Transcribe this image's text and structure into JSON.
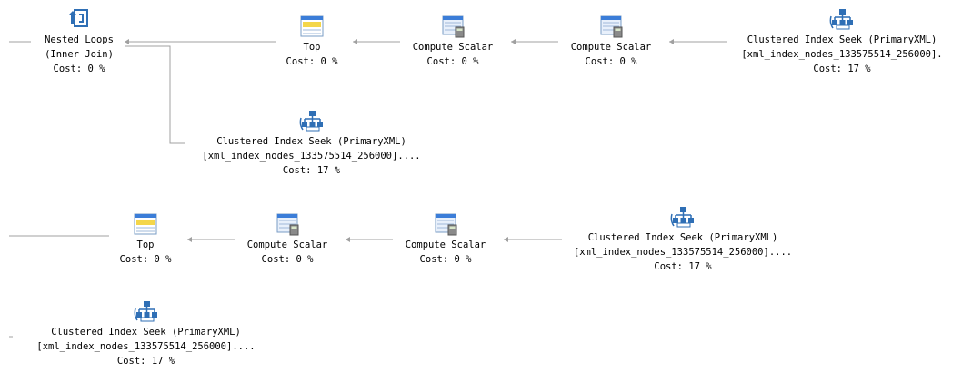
{
  "plan": {
    "nodes": {
      "nested_loops": {
        "name": "Nested Loops",
        "sub": "(Inner Join)",
        "cost": "Cost: 0 %"
      },
      "top_1": {
        "name": "Top",
        "cost": "Cost: 0 %"
      },
      "cs_1a": {
        "name": "Compute Scalar",
        "cost": "Cost: 0 %"
      },
      "cs_1b": {
        "name": "Compute Scalar",
        "cost": "Cost: 0 %"
      },
      "cis_1": {
        "name": "Clustered Index Seek (PrimaryXML)",
        "sub": "[xml_index_nodes_133575514_256000].",
        "cost": "Cost: 17 %"
      },
      "cis_2": {
        "name": "Clustered Index Seek (PrimaryXML)",
        "sub": "[xml_index_nodes_133575514_256000]....",
        "cost": "Cost: 17 %"
      },
      "top_2": {
        "name": "Top",
        "cost": "Cost: 0 %"
      },
      "cs_2a": {
        "name": "Compute Scalar",
        "cost": "Cost: 0 %"
      },
      "cs_2b": {
        "name": "Compute Scalar",
        "cost": "Cost: 0 %"
      },
      "cis_3": {
        "name": "Clustered Index Seek (PrimaryXML)",
        "sub": "[xml_index_nodes_133575514_256000]....",
        "cost": "Cost: 17 %"
      },
      "cis_4": {
        "name": "Clustered Index Seek (PrimaryXML)",
        "sub": "[xml_index_nodes_133575514_256000]....",
        "cost": "Cost: 17 %"
      }
    },
    "icons": {
      "nested_loops": "nested-loops-icon",
      "top": "top-icon",
      "compute_scalar": "compute-scalar-icon",
      "index_seek": "clustered-index-seek-icon"
    },
    "colors": {
      "wire": "#9a9a9a",
      "icon_blue": "#2f6fb5",
      "icon_yellow": "#f4d64a"
    }
  }
}
